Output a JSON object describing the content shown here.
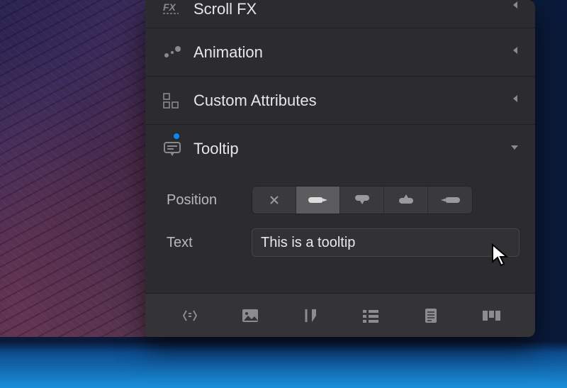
{
  "sections": {
    "scroll_fx": {
      "label": "Scroll FX"
    },
    "animation": {
      "label": "Animation"
    },
    "custom_attributes": {
      "label": "Custom Attributes"
    },
    "tooltip": {
      "label": "Tooltip"
    }
  },
  "tooltip_panel": {
    "position_label": "Position",
    "text_label": "Text",
    "text_value": "This is a tooltip"
  }
}
